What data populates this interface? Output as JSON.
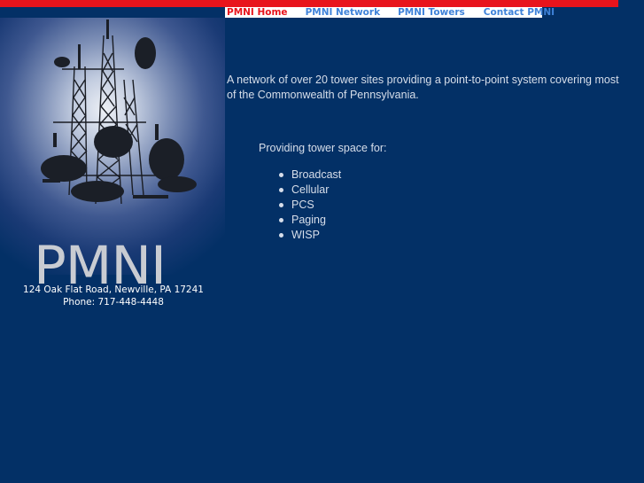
{
  "nav": {
    "items": [
      {
        "label": "PMNI Home",
        "active": true
      },
      {
        "label": "PMNI Network",
        "active": false
      },
      {
        "label": "PMNI Towers",
        "active": false
      },
      {
        "label": "Contact PMNI",
        "active": false
      }
    ]
  },
  "hero": {
    "brand": "PMNI",
    "image": "radio-tower-image"
  },
  "contact": {
    "address": "124 Oak Flat Road, Newville, PA 17241",
    "phone": "Phone: 717-448-4448"
  },
  "main": {
    "intro": "A network of over 20 tower sites providing a point-to-point system covering most of the Commonwealth of Pennsylvania.",
    "providing_label": "Providing tower space for:",
    "services": [
      "Broadcast",
      "Cellular",
      "PCS",
      "Paging",
      "WISP"
    ]
  },
  "colors": {
    "background": "#033066",
    "accent_red": "#e8141c",
    "nav_link": "#3f82d9",
    "nav_background": "#ffffff",
    "text": "#d7deea"
  }
}
